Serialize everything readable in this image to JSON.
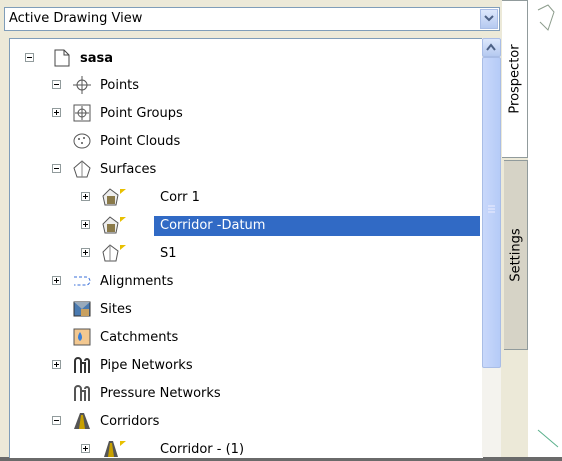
{
  "combo": {
    "value": "Active Drawing View"
  },
  "tabs": [
    "Prospector",
    "Settings"
  ],
  "tree": {
    "root": "sasa",
    "items": [
      {
        "label": "Points"
      },
      {
        "label": "Point Groups"
      },
      {
        "label": "Point Clouds"
      },
      {
        "label": "Surfaces"
      },
      {
        "label": "Corr 1"
      },
      {
        "label": "Corridor -Datum",
        "selected": true
      },
      {
        "label": "S1"
      },
      {
        "label": "Alignments"
      },
      {
        "label": "Sites"
      },
      {
        "label": "Catchments"
      },
      {
        "label": "Pipe Networks"
      },
      {
        "label": "Pressure Networks"
      },
      {
        "label": "Corridors"
      },
      {
        "label": "Corridor - (1)"
      }
    ]
  },
  "colors": {
    "selection": "#316ac5",
    "tab_inactive": "#d6d3c6"
  },
  "icons": [
    "document-icon",
    "points-icon",
    "point-groups-icon",
    "point-clouds-icon",
    "surface-icon",
    "alignment-icon",
    "sites-icon",
    "catchment-icon",
    "pipe-network-icon",
    "pressure-network-icon",
    "corridor-icon"
  ]
}
